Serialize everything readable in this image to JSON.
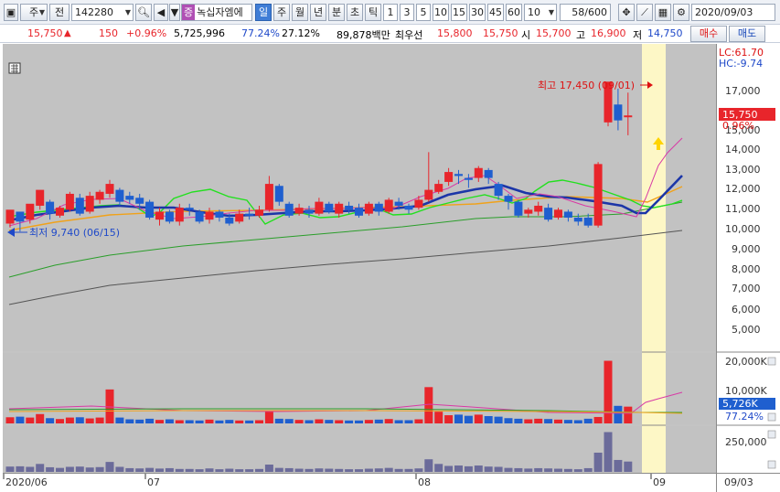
{
  "toolbar": {
    "period_short": "주",
    "prev_label": "전",
    "code": "142280",
    "stock_tag": "증",
    "stock_name": "녹십자엠에",
    "periods": [
      "일",
      "주",
      "월",
      "년",
      "분",
      "초",
      "틱"
    ],
    "period_selected": "일",
    "counts": [
      "1",
      "3",
      "5",
      "10",
      "15",
      "30",
      "45",
      "60"
    ],
    "count_value": "10",
    "page_counter": "58",
    "page_total": "/600",
    "date": "2020/09/03"
  },
  "info": {
    "price": "15,750",
    "change_arrow": "▲",
    "change": "150",
    "change_pct": "+0.96%",
    "volume": "5,725,996",
    "volume_ratio": "77.24%",
    "turnover": "27.12%",
    "amount": "89,878백만",
    "priority_label": "최우선",
    "ask": "15,800",
    "bid": "15,750",
    "open_label": "시",
    "open": "15,700",
    "high_label": "고",
    "high": "16,900",
    "low_label": "저",
    "low": "14,750",
    "buy_label": "매수",
    "sell_label": "매도"
  },
  "chart_data": {
    "type": "candlestick",
    "price_axis": {
      "ticks": [
        "17,000",
        "16,000",
        "15,000",
        "14,000",
        "13,000",
        "12,000",
        "11,000",
        "10,000",
        "9,000",
        "8,000",
        "7,000",
        "6,000",
        "5,000"
      ],
      "current_price": "15,750",
      "current_change": "0.96%",
      "lc_label": "LC:61.70",
      "hc_label": "HC:-9.74"
    },
    "annotations": {
      "max_label": "최고 17,450 (09/01)",
      "min_label": "최저 9,740 (06/15)"
    },
    "volume_axis": {
      "ticks": [
        "20,000K",
        "10,000K"
      ],
      "current": "5,726K",
      "ratio": "77.24%"
    },
    "amount_axis": {
      "ticks": [
        "250,000"
      ]
    },
    "x_labels": [
      "2020/06",
      "07",
      "08",
      "09",
      "09/03"
    ],
    "candles": [
      [
        10.3,
        11.0,
        10.1,
        10.9
      ],
      [
        10.9,
        10.4,
        9.9,
        10.7
      ],
      [
        10.5,
        11.3,
        10.3,
        11.0
      ],
      [
        11.2,
        12.0,
        11.0,
        11.8
      ],
      [
        11.4,
        10.8,
        10.5,
        11.5
      ],
      [
        10.7,
        11.1,
        10.6,
        11.2
      ],
      [
        11.0,
        11.8,
        10.9,
        11.9
      ],
      [
        11.6,
        10.8,
        10.7,
        11.8
      ],
      [
        10.9,
        11.7,
        10.8,
        11.9
      ],
      [
        11.5,
        11.9,
        11.3,
        12.0
      ],
      [
        11.8,
        12.3,
        11.6,
        12.5
      ],
      [
        12.0,
        11.4,
        11.2,
        12.1
      ],
      [
        11.7,
        11.5,
        11.3,
        11.9
      ],
      [
        11.6,
        11.3,
        11.0,
        11.8
      ],
      [
        11.4,
        10.6,
        10.5,
        11.5
      ],
      [
        10.5,
        10.9,
        10.2,
        11.1
      ],
      [
        10.9,
        10.4,
        10.3,
        11.0
      ],
      [
        10.4,
        11.1,
        10.2,
        11.3
      ],
      [
        11.1,
        11.0,
        10.7,
        11.3
      ],
      [
        10.9,
        10.4,
        10.3,
        11.0
      ],
      [
        10.5,
        10.9,
        10.3,
        11.1
      ],
      [
        10.9,
        10.6,
        10.4,
        11.0
      ],
      [
        10.6,
        10.3,
        10.2,
        10.8
      ],
      [
        10.4,
        10.8,
        10.3,
        11.0
      ],
      [
        10.8,
        10.7,
        10.5,
        11.1
      ],
      [
        10.7,
        11.0,
        10.6,
        11.2
      ],
      [
        11.0,
        12.3,
        10.9,
        12.7
      ],
      [
        12.2,
        11.4,
        11.2,
        12.3
      ],
      [
        11.3,
        10.7,
        10.6,
        11.4
      ],
      [
        10.8,
        11.1,
        10.7,
        11.3
      ],
      [
        11.0,
        10.8,
        10.6,
        11.2
      ],
      [
        10.8,
        11.4,
        10.7,
        11.6
      ],
      [
        11.3,
        10.9,
        10.8,
        11.4
      ],
      [
        10.8,
        11.3,
        10.6,
        11.4
      ],
      [
        11.2,
        11.0,
        10.8,
        11.4
      ],
      [
        11.1,
        10.7,
        10.6,
        11.3
      ],
      [
        10.8,
        11.3,
        10.7,
        11.4
      ],
      [
        11.3,
        10.9,
        10.7,
        11.4
      ],
      [
        10.9,
        11.5,
        10.8,
        11.6
      ],
      [
        11.4,
        11.2,
        11.0,
        11.6
      ],
      [
        11.2,
        11.0,
        10.8,
        11.3
      ],
      [
        11.1,
        11.5,
        11.0,
        11.7
      ],
      [
        11.5,
        12.0,
        11.4,
        13.9
      ],
      [
        11.9,
        12.3,
        11.8,
        12.5
      ],
      [
        12.4,
        12.9,
        12.2,
        13.1
      ],
      [
        12.8,
        12.7,
        12.3,
        13.0
      ],
      [
        12.6,
        12.5,
        12.1,
        12.8
      ],
      [
        12.6,
        13.1,
        12.4,
        13.2
      ],
      [
        13.0,
        12.6,
        12.3,
        13.1
      ],
      [
        12.3,
        11.7,
        11.5,
        12.4
      ],
      [
        11.7,
        11.4,
        11.0,
        11.8
      ],
      [
        11.4,
        10.7,
        10.6,
        11.5
      ],
      [
        10.8,
        11.0,
        10.6,
        11.1
      ],
      [
        10.9,
        11.2,
        10.7,
        11.4
      ],
      [
        11.1,
        10.5,
        10.4,
        11.3
      ],
      [
        10.6,
        11.0,
        10.5,
        11.1
      ],
      [
        10.9,
        10.6,
        10.4,
        11.0
      ],
      [
        10.6,
        10.4,
        10.2,
        10.8
      ],
      [
        10.6,
        10.2,
        10.1,
        10.8
      ],
      [
        10.2,
        13.3,
        10.1,
        13.4
      ],
      [
        15.4,
        17.45,
        15.2,
        17.45
      ],
      [
        16.3,
        15.5,
        15.0,
        17.1
      ],
      [
        15.7,
        15.75,
        14.75,
        16.9
      ]
    ],
    "volume": [
      2.1,
      2.3,
      2.0,
      3.2,
      1.8,
      1.5,
      2.0,
      2.1,
      1.7,
      2.0,
      11.6,
      2.0,
      1.4,
      1.3,
      1.6,
      1.2,
      1.4,
      1.1,
      1.1,
      1.0,
      1.3,
      1.0,
      1.2,
      1.0,
      1.0,
      1.1,
      4.2,
      1.6,
      1.5,
      1.2,
      1.1,
      1.4,
      1.2,
      1.1,
      1.0,
      1.0,
      1.2,
      1.3,
      1.5,
      1.1,
      1.1,
      1.4,
      12.4,
      4.0,
      2.8,
      3.0,
      2.6,
      3.0,
      2.5,
      2.3,
      1.8,
      1.6,
      1.4,
      1.6,
      1.5,
      1.3,
      1.2,
      1.1,
      1.6,
      2.2,
      21.4,
      6.0,
      5.73
    ],
    "amount": [
      40,
      42,
      38,
      60,
      35,
      30,
      38,
      40,
      33,
      36,
      75,
      38,
      28,
      26,
      30,
      25,
      28,
      22,
      22,
      20,
      26,
      20,
      24,
      20,
      20,
      22,
      55,
      30,
      28,
      24,
      22,
      26,
      24,
      22,
      20,
      20,
      24,
      26,
      30,
      22,
      22,
      26,
      95,
      60,
      45,
      48,
      42,
      48,
      40,
      38,
      30,
      28,
      25,
      28,
      26,
      24,
      22,
      20,
      28,
      145,
      300,
      90,
      78
    ],
    "colors": {
      "up": "#e8252b",
      "down": "#1f5fcf",
      "ma5": "#d83aa6",
      "ma20": "#1c36a8",
      "ma60": "#f0a21a",
      "ma120": "#2a9e2a",
      "envelope": "#22e01e",
      "ma_long": "#555555",
      "highlight": "#fdf7c6",
      "plot_bg": "#c2c2c2"
    }
  }
}
